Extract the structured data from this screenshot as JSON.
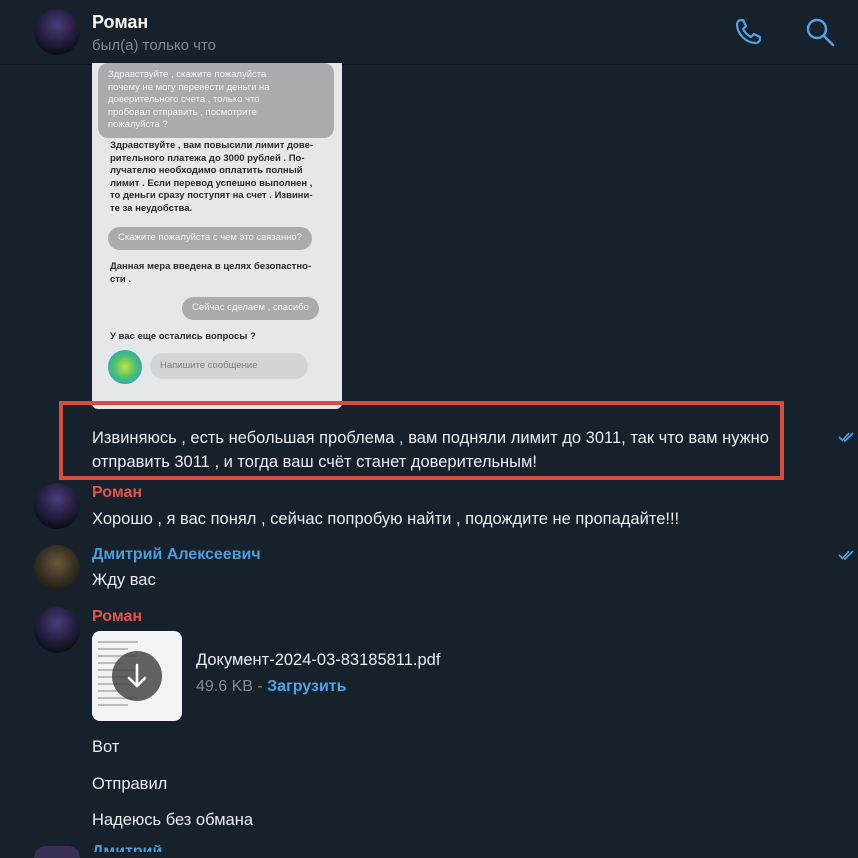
{
  "header": {
    "contact_name": "Роман",
    "status": "был(а) только что",
    "icons": {
      "call": "phone-icon",
      "search": "search-icon"
    }
  },
  "screenshot": {
    "msg1": "Здравствуйте , скажите пожалуйста\nпочему не могу перевести деньги на\nдоверительного счета , только что\nпробовал отправить , посмотрите\nпожалуйста ?",
    "msg2": "Здравствуйте , вам повысили лимит дове-\nрительного платежа до 3000 рублей . По-\nлучателю необходимо оплатить полный\nлимит . Если перевод успешно выполнен ,\nто деньги сразу поступят на счет . Извини-\nте за неудобства.",
    "msg3": "Скажите пожалуйста с чем это связанно?",
    "msg4": "Данная мера введена в целях безопастно-\nсти .",
    "msg5": "Сейчас сделаем , спасибо",
    "msg6": "У вас еще остались вопросы ?",
    "input_placeholder": "Напишите сообщение"
  },
  "messages": {
    "m1_text": "Извиняюсь , есть небольшая проблема , вам подняли лимит до 3011, так что вам нужно отправить 3011 , и тогда ваш счёт станет доверительным!",
    "m2_sender": "Роман",
    "m2_text": "Хорошо , я вас понял , сейчас попробую найти , подождите не пропадайте!!!",
    "m3_sender": "Дмитрий Алексеевич",
    "m3_text": "Жду вас",
    "m4_sender": "Роман",
    "document": {
      "name": "Документ-2024-03-83185811.pdf",
      "size": "49.6 KB",
      "separator": " - ",
      "download": "Загрузить"
    },
    "m5_text": "Вот",
    "m6_text": "Отправил",
    "m7_text": "Надеюсь без обмана",
    "next_sender": "Дмитрий Алексеевич"
  },
  "colors": {
    "background": "#17212b",
    "roman_name": "#e0554d",
    "dima_name": "#4e9ddb",
    "link": "#4ea4e6",
    "highlight_border": "#d64c3f"
  }
}
